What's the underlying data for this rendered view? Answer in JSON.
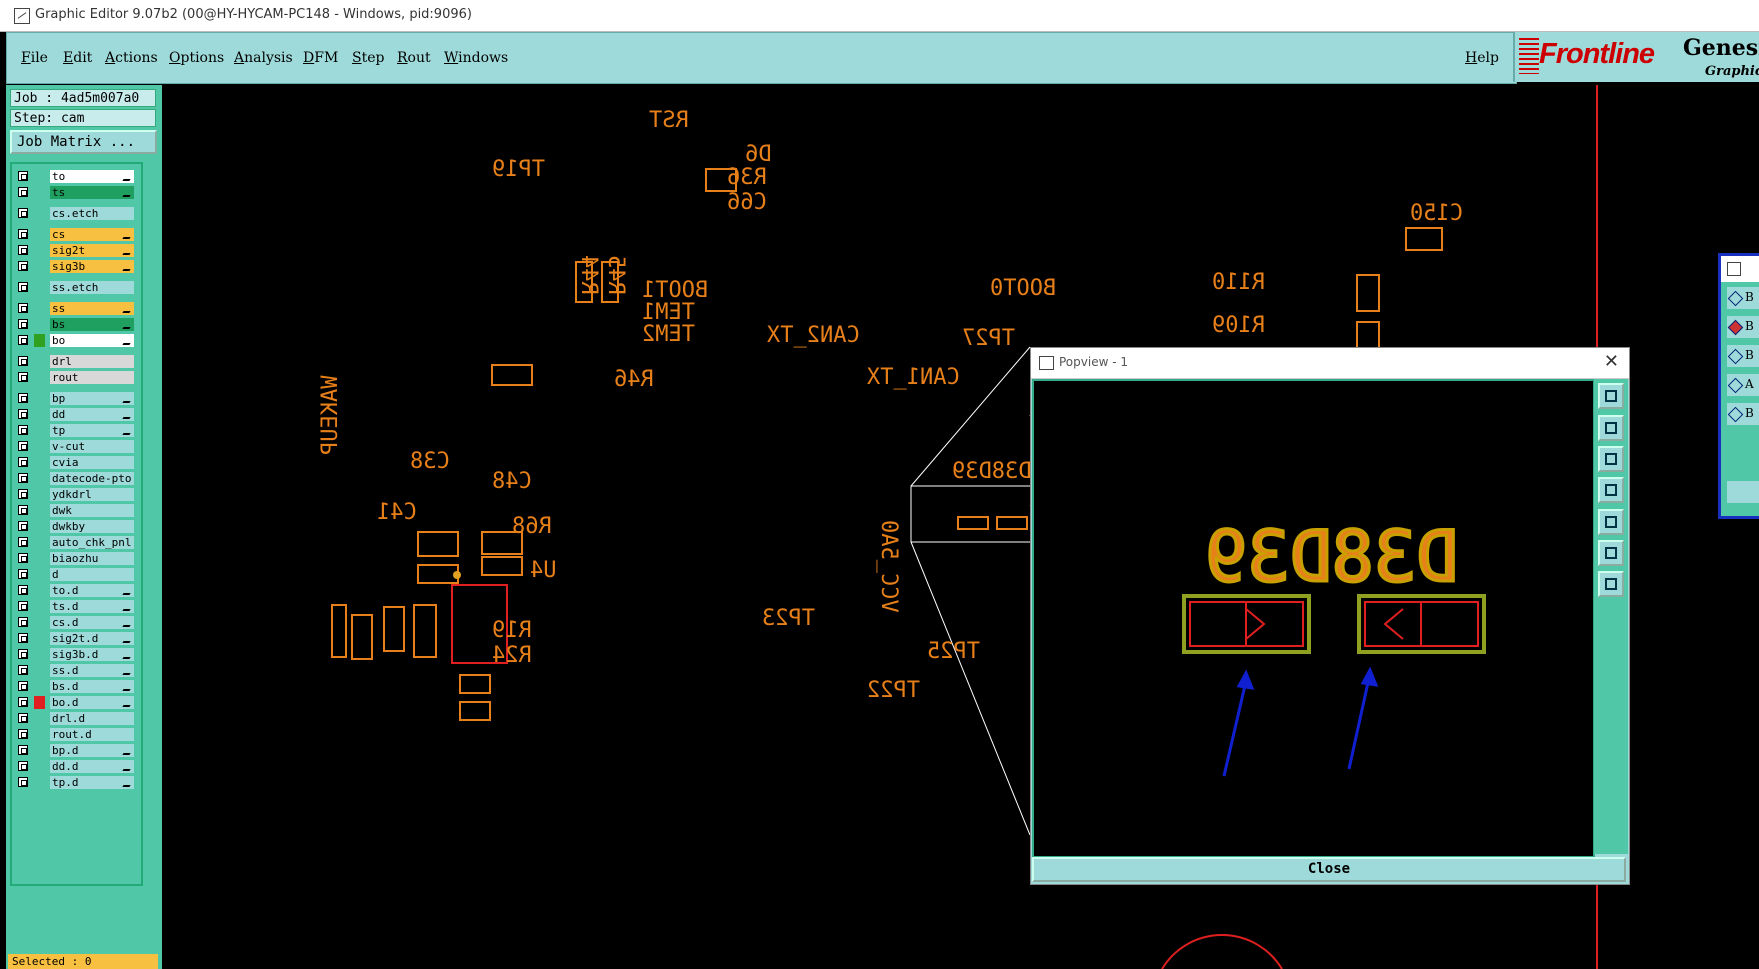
{
  "window": {
    "title": "Graphic Editor 9.07b2 (00@HY-HYCAM-PC148 - Windows, pid:9096)"
  },
  "menu": [
    "File",
    "Edit",
    "Actions",
    "Options",
    "Analysis",
    "DFM",
    "Step",
    "Rout",
    "Windows"
  ],
  "help": "Help",
  "brand": {
    "logo": "Frontline",
    "product": "Genesis",
    "subtitle": "Graphic"
  },
  "job": {
    "job": "Job : 4ad5m007a0",
    "step": "Step: cam",
    "matrix": "Job Matrix ..."
  },
  "layers": [
    {
      "name": "to",
      "color": "#ffffff",
      "pen": true,
      "mark": ""
    },
    {
      "name": "ts",
      "color": "#20a060",
      "pen": true,
      "mark": ""
    },
    {
      "name": "cs.etch",
      "color": "#9ddad9",
      "pen": false,
      "mark": ""
    },
    {
      "name": "cs",
      "color": "#f8c040",
      "pen": true,
      "mark": ""
    },
    {
      "name": "sig2t",
      "color": "#f8c040",
      "pen": true,
      "mark": ""
    },
    {
      "name": "sig3b",
      "color": "#f8c040",
      "pen": true,
      "mark": ""
    },
    {
      "name": "ss.etch",
      "color": "#9ddad9",
      "pen": false,
      "mark": ""
    },
    {
      "name": "ss",
      "color": "#f8c040",
      "pen": true,
      "mark": ""
    },
    {
      "name": "bs",
      "color": "#20a060",
      "pen": true,
      "mark": ""
    },
    {
      "name": "bo",
      "color": "#ffffff",
      "pen": true,
      "mark": "#30a020"
    },
    {
      "name": "drl",
      "color": "#d8d8d8",
      "pen": false,
      "mark": ""
    },
    {
      "name": "rout",
      "color": "#d8d8d8",
      "pen": false,
      "mark": ""
    },
    {
      "name": "bp",
      "color": "#9ddad9",
      "pen": true,
      "mark": ""
    },
    {
      "name": "dd",
      "color": "#9ddad9",
      "pen": true,
      "mark": ""
    },
    {
      "name": "tp",
      "color": "#9ddad9",
      "pen": true,
      "mark": ""
    },
    {
      "name": "v-cut",
      "color": "#9ddad9",
      "pen": false,
      "mark": ""
    },
    {
      "name": "cvia",
      "color": "#9ddad9",
      "pen": false,
      "mark": ""
    },
    {
      "name": "datecode-pto",
      "color": "#9ddad9",
      "pen": false,
      "mark": ""
    },
    {
      "name": "ydkdrl",
      "color": "#9ddad9",
      "pen": false,
      "mark": ""
    },
    {
      "name": "dwk",
      "color": "#9ddad9",
      "pen": false,
      "mark": ""
    },
    {
      "name": "dwkby",
      "color": "#9ddad9",
      "pen": false,
      "mark": ""
    },
    {
      "name": "auto_chk_pnl",
      "color": "#9ddad9",
      "pen": false,
      "mark": ""
    },
    {
      "name": "biaozhu",
      "color": "#9ddad9",
      "pen": false,
      "mark": ""
    },
    {
      "name": "d",
      "color": "#9ddad9",
      "pen": false,
      "mark": ""
    },
    {
      "name": "to.d",
      "color": "#9ddad9",
      "pen": true,
      "mark": ""
    },
    {
      "name": "ts.d",
      "color": "#9ddad9",
      "pen": true,
      "mark": ""
    },
    {
      "name": "cs.d",
      "color": "#9ddad9",
      "pen": true,
      "mark": ""
    },
    {
      "name": "sig2t.d",
      "color": "#9ddad9",
      "pen": true,
      "mark": ""
    },
    {
      "name": "sig3b.d",
      "color": "#9ddad9",
      "pen": true,
      "mark": ""
    },
    {
      "name": "ss.d",
      "color": "#9ddad9",
      "pen": true,
      "mark": ""
    },
    {
      "name": "bs.d",
      "color": "#9ddad9",
      "pen": true,
      "mark": ""
    },
    {
      "name": "bo.d",
      "color": "#9ddad9",
      "pen": true,
      "mark": "#e02020"
    },
    {
      "name": "drl.d",
      "color": "#9ddad9",
      "pen": false,
      "mark": ""
    },
    {
      "name": "rout.d",
      "color": "#9ddad9",
      "pen": false,
      "mark": ""
    },
    {
      "name": "bp.d",
      "color": "#9ddad9",
      "pen": true,
      "mark": ""
    },
    {
      "name": "dd.d",
      "color": "#9ddad9",
      "pen": true,
      "mark": ""
    },
    {
      "name": "tp.d",
      "color": "#9ddad9",
      "pen": true,
      "mark": ""
    }
  ],
  "selected": "Selected : 0",
  "canvas_labels": [
    "RST",
    "D6",
    "R36",
    "C66",
    "TP19",
    "R44",
    "R45",
    "BOOT1",
    "TEM1",
    "TEM2",
    "CAN2_TX",
    "BOOT0",
    "TP27",
    "CAN1_TX",
    "R46",
    "C150",
    "R110",
    "R109",
    "WAKEUP",
    "C38",
    "C48",
    "C41",
    "R68",
    "U4",
    "VCC_5A0",
    "D38D39",
    "TP23",
    "TP25",
    "TP22",
    "R19",
    "R24"
  ],
  "popview": {
    "title": "Popview - 1",
    "zoom_label": "D38D39",
    "close": "Close"
  },
  "side_panel": {
    "rows": [
      "B",
      "B",
      "B",
      "A",
      "B"
    ]
  },
  "colors": {
    "panel": "#50c8a8",
    "bar": "#9ddad9",
    "trace": "#e8801a",
    "accent": "#f8c040"
  }
}
